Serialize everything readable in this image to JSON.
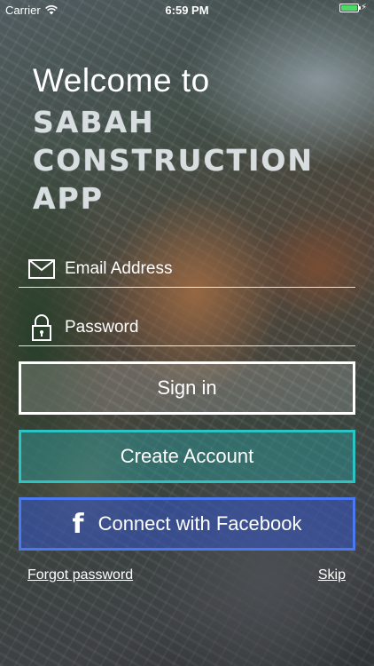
{
  "status_bar": {
    "carrier": "Carrier",
    "time": "6:59 PM"
  },
  "welcome": "Welcome to",
  "app_name_lines": [
    "SABAH",
    "CONSTRUCTION",
    "APP"
  ],
  "email": {
    "placeholder": "Email Address",
    "icon": "mail-icon"
  },
  "password": {
    "placeholder": "Password",
    "icon": "lock-icon"
  },
  "buttons": {
    "sign_in": "Sign in",
    "create_account": "Create Account",
    "facebook": "Connect with Facebook",
    "facebook_icon": "f"
  },
  "links": {
    "forgot": "Forgot password",
    "skip": "Skip"
  },
  "colors": {
    "create_border": "#2cc3c3",
    "facebook_border": "#4a78f0",
    "battery": "#4cd964"
  }
}
